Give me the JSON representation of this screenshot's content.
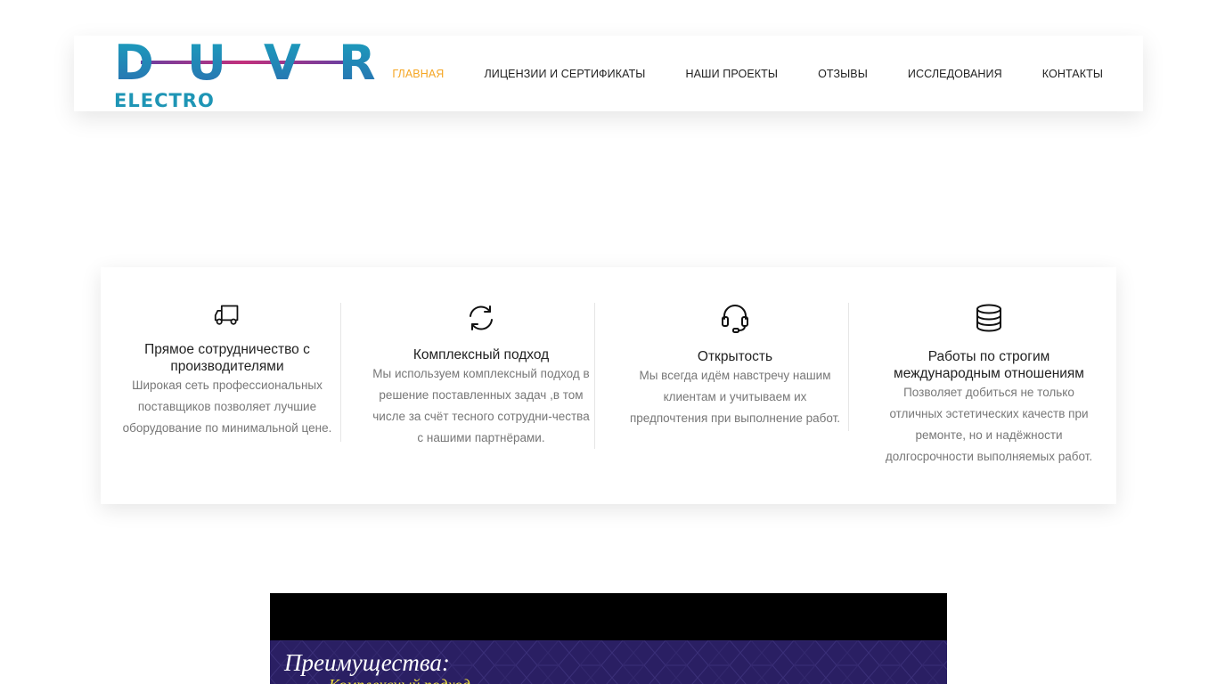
{
  "brand": {
    "letters": [
      "D",
      "U",
      "V",
      "R"
    ],
    "sub": "ELECTRO",
    "colors": {
      "teal": "#1e95b5",
      "magenta": "#b0307f",
      "purple": "#6b3fa0"
    }
  },
  "nav": {
    "items": [
      {
        "label": "ГЛАВНАЯ",
        "active": true
      },
      {
        "label": "ЛИЦЕНЗИИ И СЕРТИФИКАТЫ",
        "active": false
      },
      {
        "label": "НАШИ ПРОЕКТЫ",
        "active": false
      },
      {
        "label": "ОТЗЫВЫ",
        "active": false
      },
      {
        "label": "ИССЛЕДОВАНИЯ",
        "active": false
      },
      {
        "label": "КОНТАКТЫ",
        "active": false
      }
    ],
    "active_color": "#f5a623"
  },
  "features": [
    {
      "icon": "truck-icon",
      "title_lines": [
        "Прямое сотрудничество с",
        "производителями"
      ],
      "text_lines": [
        "Широкая сеть профессиональных",
        "поставщиков позволяет лучшие",
        "оборудование по минимальной цене."
      ]
    },
    {
      "icon": "refresh-icon",
      "title_lines": [
        "Комплексный подход"
      ],
      "text_lines": [
        "Мы используем комплексный подход в",
        "решение поставленных задач ,в том",
        "числе за счёт тесного сотрудни-чества",
        "с нашими партнёрами."
      ]
    },
    {
      "icon": "headset-icon",
      "title_lines": [
        "Открытость"
      ],
      "text_lines": [
        "Мы всегда идём навстречу нашим",
        "клиентам и учитываем их",
        "предпочтения при выполнение работ."
      ]
    },
    {
      "icon": "database-icon",
      "title_lines": [
        "Работы по строгим",
        "международным отношениям"
      ],
      "text_lines": [
        "Позволяет добиться не только",
        "отличных эстетических качеств при",
        "ремонте, но и надёжности",
        "долгосрочности выполняемых работ."
      ]
    }
  ],
  "video": {
    "title": "Преимущества:",
    "subtitle": "Комплексный подход"
  }
}
